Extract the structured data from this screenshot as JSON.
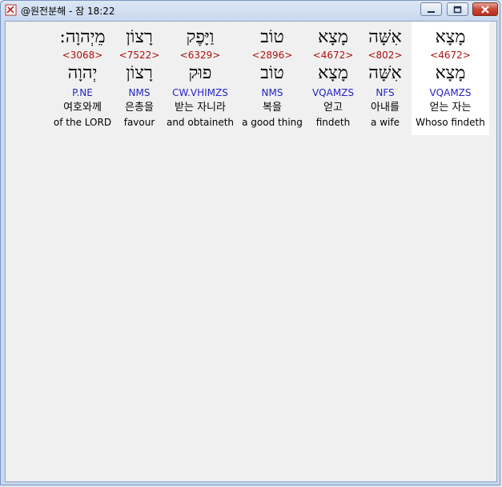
{
  "window": {
    "title": "@원전분해 - 잠 18:22",
    "icon": "app-book-icon"
  },
  "title_controls": [
    {
      "name": "minimize",
      "icon": "minimize-icon"
    },
    {
      "name": "maximize",
      "icon": "maximize-icon"
    },
    {
      "name": "close",
      "icon": "close-icon"
    }
  ],
  "words": [
    {
      "hebrew": "מֵיְהוָה:",
      "strong": "<3068>",
      "hebrew_root": "יְהוָה",
      "parse": "P.NE",
      "korean": "여호와께",
      "english": "of the LORD"
    },
    {
      "hebrew": "רָצוֹן",
      "strong": "<7522>",
      "hebrew_root": "רָצוֹן",
      "parse": "NMS",
      "korean": "은총을",
      "english": "favour"
    },
    {
      "hebrew": "וַיָּפֶק",
      "strong": "<6329>",
      "hebrew_root": "פוּק",
      "parse": "CW.VHIMZS",
      "korean": "받는 자니라",
      "english": "and obtaineth"
    },
    {
      "hebrew": "טוֹב",
      "strong": "<2896>",
      "hebrew_root": "טוֹב",
      "parse": "NMS",
      "korean": "복을",
      "english": "a good thing"
    },
    {
      "hebrew": "מָצָא",
      "strong": "<4672>",
      "hebrew_root": "מָצָא",
      "parse": "VQAMZS",
      "korean": "얻고",
      "english": "findeth"
    },
    {
      "hebrew": "אִשָּׁה",
      "strong": "<802>",
      "hebrew_root": "אִשָּׁה",
      "parse": "NFS",
      "korean": "아내를",
      "english": "a wife"
    },
    {
      "hebrew": "מָצָא",
      "strong": "<4672>",
      "hebrew_root": "מָצָא",
      "parse": "VQAMZS",
      "korean": "얻는 자는",
      "english": "Whoso findeth"
    }
  ],
  "colors": {
    "strong_number": "#b01010",
    "parse_code": "#2424c8",
    "selected_column_bg": "#ffffff",
    "client_bg": "#f0f0f0"
  },
  "selected_word_index": 6
}
